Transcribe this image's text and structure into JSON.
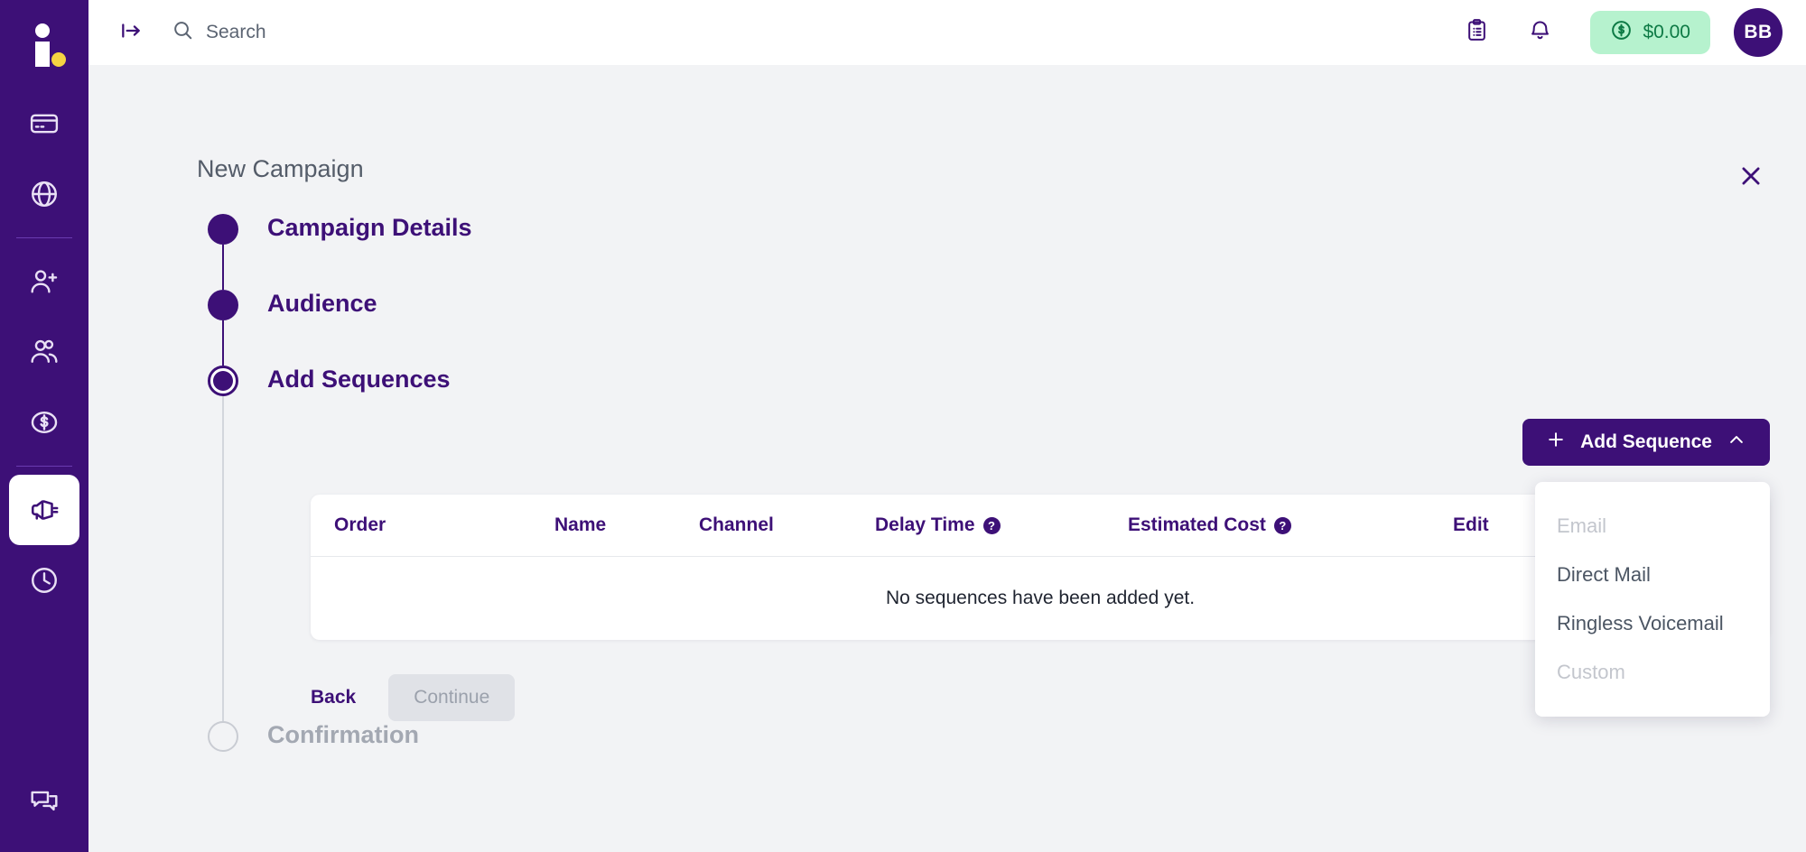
{
  "brand": {
    "primary": "#3d1077",
    "accent_yellow": "#f5d442",
    "wallet_bg": "#b6f2ce",
    "wallet_fg": "#0d7a45",
    "logo_name": "logo-i-dot"
  },
  "sidebar": {
    "items": [
      {
        "name": "credit-card-icon",
        "label": "Billing"
      },
      {
        "name": "globe-icon",
        "label": "Network"
      },
      {
        "name": "user-plus-icon",
        "label": "Add Contact"
      },
      {
        "name": "users-icon",
        "label": "Contacts"
      },
      {
        "name": "dollar-circle-icon",
        "label": "Deals"
      },
      {
        "name": "megaphone-icon",
        "label": "Campaigns"
      },
      {
        "name": "clock-icon",
        "label": "History"
      },
      {
        "name": "chat-icon",
        "label": "Messages"
      }
    ],
    "active": "megaphone-icon"
  },
  "topbar": {
    "collapse_icon": "collapse-panel-icon",
    "search": {
      "placeholder": "Search",
      "value": ""
    },
    "clipboard_icon": "clipboard-list-icon",
    "bell_icon": "bell-icon",
    "wallet": {
      "icon": "dollar-circle-icon",
      "amount": "$0.00"
    },
    "avatar_initials": "BB"
  },
  "page": {
    "title": "New Campaign",
    "close_icon": "close-icon"
  },
  "stepper": {
    "steps": [
      {
        "label": "Campaign Details",
        "state": "done"
      },
      {
        "label": "Audience",
        "state": "done"
      },
      {
        "label": "Add Sequences",
        "state": "current"
      },
      {
        "label": "Confirmation",
        "state": "pending"
      }
    ]
  },
  "sequences": {
    "add_button": {
      "label": "Add Sequence",
      "plus_icon": "plus-icon",
      "chevron_icon": "chevron-up-icon"
    },
    "dropdown": {
      "open": true,
      "options": [
        {
          "label": "Email",
          "disabled": true
        },
        {
          "label": "Direct Mail",
          "disabled": false
        },
        {
          "label": "Ringless Voicemail",
          "disabled": false
        },
        {
          "label": "Custom",
          "disabled": true
        }
      ]
    },
    "table": {
      "columns": [
        {
          "label": "Order",
          "help": false
        },
        {
          "label": "Name",
          "help": false
        },
        {
          "label": "Channel",
          "help": false
        },
        {
          "label": "Delay Time",
          "help": true
        },
        {
          "label": "Estimated Cost",
          "help": true
        },
        {
          "label": "Edit",
          "help": false
        }
      ],
      "help_glyph": "?",
      "rows": [],
      "empty_message": "No sequences have been added yet."
    },
    "actions": {
      "back_label": "Back",
      "continue_label": "Continue",
      "continue_disabled": true
    }
  }
}
